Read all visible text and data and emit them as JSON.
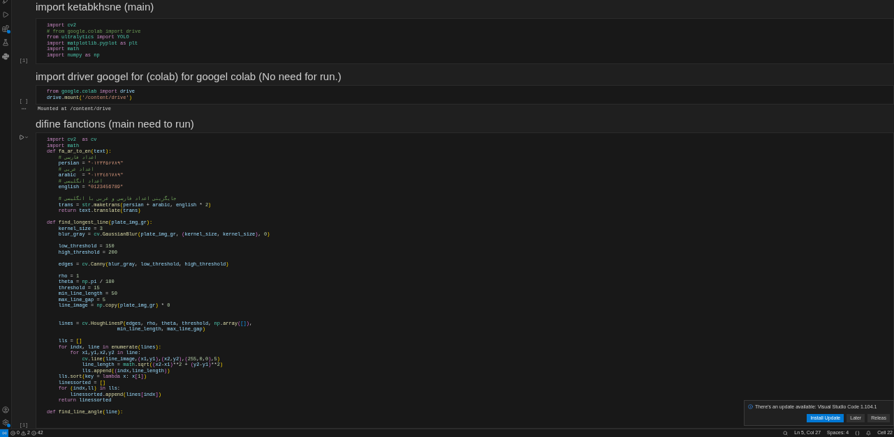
{
  "notebook": [
    {
      "kind": "markdown",
      "text": "import ketabkhsne (main)"
    },
    {
      "kind": "code",
      "run_button": false,
      "execution_label": "[1]",
      "lines": [
        {
          "kind": "code",
          "tokens": [
            {
              "kw": "import"
            },
            {
              "mod": " cv2"
            }
          ]
        },
        {
          "kind": "code",
          "tokens": [
            {
              "com": "# from google.colab import drive"
            }
          ]
        },
        {
          "kind": "code",
          "tokens": [
            {
              "kw": "from"
            },
            {
              "mod": " ultralytics "
            },
            {
              "kw": "import"
            },
            {
              "mod": " YOLO"
            }
          ]
        },
        {
          "kind": "code",
          "tokens": [
            {
              "kw": "import"
            },
            {
              "mod": " matplotlib.pyplot "
            },
            {
              "kw": "as"
            },
            {
              "mod": " plt"
            }
          ]
        },
        {
          "kind": "code",
          "tokens": [
            {
              "kw": "import"
            },
            {
              "mod": " math"
            }
          ]
        },
        {
          "kind": "code",
          "tokens": [
            {
              "kw": "import"
            },
            {
              "mod": " numpy "
            },
            {
              "kw": "as"
            },
            {
              "mod": " np"
            }
          ]
        }
      ]
    },
    {
      "kind": "markdown",
      "text": "import driver googel for (colab) for googel colab (No need for run.)"
    },
    {
      "kind": "code",
      "run_button": false,
      "execution_label": "[ ]",
      "lines": [
        {
          "kind": "code",
          "tokens": [
            {
              "kw": "from"
            },
            {
              "mod": " google.colab "
            },
            {
              "kw": "import"
            },
            {
              "var": " drive"
            }
          ]
        },
        {
          "kind": "code",
          "tokens": [
            {
              "var": "drive"
            },
            {
              "op": "."
            },
            {
              "fn": "mount"
            },
            {
              "br": "("
            },
            {
              "str": "'/content/drive'"
            },
            {
              "br": ")"
            }
          ]
        }
      ],
      "output": "Mounted at /content/drive"
    },
    {
      "kind": "markdown",
      "text": "difine fanctions (main need to run)"
    },
    {
      "kind": "code",
      "run_button": true,
      "execution_label": "[1]",
      "lines": [
        {
          "kind": "code",
          "tokens": [
            {
              "kw": "import"
            },
            {
              "mod": " cv2  "
            },
            {
              "kw": "as"
            },
            {
              "mod": " cv"
            }
          ]
        },
        {
          "kind": "code",
          "tokens": [
            {
              "kw": "import"
            },
            {
              "mod": " math"
            }
          ]
        },
        {
          "kind": "code",
          "tokens": [
            {
              "kw": "def"
            },
            {
              "fn": " fa_ar_to_en"
            },
            {
              "br": "("
            },
            {
              "var": "text"
            },
            {
              "br": "):"
            }
          ]
        },
        {
          "kind": "code",
          "tokens": [
            {
              "com": "    # اعداد فارسی"
            }
          ]
        },
        {
          "kind": "code",
          "tokens": [
            {
              "var": "    persian"
            },
            {
              "op": " = "
            },
            {
              "str": "\"۰۱۲۳۴۵۶۷۸۹\""
            }
          ]
        },
        {
          "kind": "code",
          "tokens": [
            {
              "com": "    # اعداد عربی"
            }
          ]
        },
        {
          "kind": "code",
          "tokens": [
            {
              "var": "    arabic"
            },
            {
              "op": "  = "
            },
            {
              "str": "\"٠١٢٣٤٥٦٧٨٩\""
            }
          ]
        },
        {
          "kind": "code",
          "tokens": [
            {
              "com": "    # اعداد انگلیسی"
            }
          ]
        },
        {
          "kind": "code",
          "tokens": [
            {
              "var": "    english"
            },
            {
              "op": " = "
            },
            {
              "str": "\"0123456789\""
            }
          ]
        },
        {
          "kind": "blank"
        },
        {
          "kind": "code",
          "tokens": [
            {
              "com": "    # جایگزینی اعداد فارسی و عربی با انگلیسی"
            }
          ]
        },
        {
          "kind": "code",
          "tokens": [
            {
              "var": "    trans"
            },
            {
              "op": " = "
            },
            {
              "mod": "str"
            },
            {
              "op": "."
            },
            {
              "fn": "maketrans"
            },
            {
              "br": "("
            },
            {
              "var": "persian"
            },
            {
              "op": " + "
            },
            {
              "var": "arabic"
            },
            {
              "op": ", "
            },
            {
              "var": "english"
            },
            {
              "op": " * "
            },
            {
              "num": "2"
            },
            {
              "br": ")"
            }
          ]
        },
        {
          "kind": "code",
          "tokens": [
            {
              "kw": "    return"
            },
            {
              "var": " text"
            },
            {
              "op": "."
            },
            {
              "fn": "translate"
            },
            {
              "br": "("
            },
            {
              "var": "trans"
            },
            {
              "br": ")"
            }
          ]
        },
        {
          "kind": "blank"
        },
        {
          "kind": "code",
          "tokens": [
            {
              "kw": "def"
            },
            {
              "fn": " find_longest_line"
            },
            {
              "br": "("
            },
            {
              "var": "plate_img_gr"
            },
            {
              "br": "):"
            }
          ]
        },
        {
          "kind": "code",
          "tokens": [
            {
              "var": "    kernel_size"
            },
            {
              "op": " = "
            },
            {
              "num": "3"
            }
          ]
        },
        {
          "kind": "code",
          "tokens": [
            {
              "var": "    blur_gray"
            },
            {
              "op": " = "
            },
            {
              "mod": "cv"
            },
            {
              "op": "."
            },
            {
              "fn": "GaussianBlur"
            },
            {
              "br": "("
            },
            {
              "var": "plate_img_gr"
            },
            {
              "op": ", "
            },
            {
              "br2": "("
            },
            {
              "var": "kernel_size"
            },
            {
              "op": ", "
            },
            {
              "var": "kernel_size"
            },
            {
              "br2": ")"
            },
            {
              "op": ", "
            },
            {
              "num": "0"
            },
            {
              "br": ")"
            }
          ]
        },
        {
          "kind": "blank"
        },
        {
          "kind": "code",
          "tokens": [
            {
              "var": "    low_threshold"
            },
            {
              "op": " = "
            },
            {
              "num": "150"
            }
          ]
        },
        {
          "kind": "code",
          "tokens": [
            {
              "var": "    high_threshold"
            },
            {
              "op": " = "
            },
            {
              "num": "200"
            }
          ]
        },
        {
          "kind": "blank"
        },
        {
          "kind": "code",
          "tokens": [
            {
              "var": "    edges"
            },
            {
              "op": " = "
            },
            {
              "mod": "cv"
            },
            {
              "op": "."
            },
            {
              "fn": "Canny"
            },
            {
              "br": "("
            },
            {
              "var": "blur_gray"
            },
            {
              "op": ", "
            },
            {
              "var": "low_threshold"
            },
            {
              "op": ", "
            },
            {
              "var": "high_threshold"
            },
            {
              "br": ")"
            }
          ]
        },
        {
          "kind": "blank"
        },
        {
          "kind": "code",
          "tokens": [
            {
              "var": "    rho"
            },
            {
              "op": " = "
            },
            {
              "num": "1"
            }
          ]
        },
        {
          "kind": "code",
          "tokens": [
            {
              "var": "    theta"
            },
            {
              "op": " = "
            },
            {
              "mod": "np"
            },
            {
              "op": "."
            },
            {
              "var": "pi"
            },
            {
              "op": " / "
            },
            {
              "num": "180"
            }
          ]
        },
        {
          "kind": "code",
          "tokens": [
            {
              "var": "    threshold"
            },
            {
              "op": " = "
            },
            {
              "num": "15"
            }
          ]
        },
        {
          "kind": "code",
          "tokens": [
            {
              "var": "    min_line_length"
            },
            {
              "op": " = "
            },
            {
              "num": "50"
            }
          ]
        },
        {
          "kind": "code",
          "tokens": [
            {
              "var": "    max_line_gap"
            },
            {
              "op": " = "
            },
            {
              "num": "5"
            }
          ]
        },
        {
          "kind": "code",
          "tokens": [
            {
              "var": "    line_image"
            },
            {
              "op": " = "
            },
            {
              "mod": "np"
            },
            {
              "op": "."
            },
            {
              "fn": "copy"
            },
            {
              "br": "("
            },
            {
              "var": "plate_img_gr"
            },
            {
              "br": ")"
            },
            {
              "op": " * "
            },
            {
              "num": "0"
            }
          ]
        },
        {
          "kind": "blank"
        },
        {
          "kind": "blank"
        },
        {
          "kind": "code",
          "tokens": [
            {
              "var": "    lines"
            },
            {
              "op": " = "
            },
            {
              "mod": "cv"
            },
            {
              "op": "."
            },
            {
              "fn": "HoughLinesP"
            },
            {
              "br": "("
            },
            {
              "var": "edges"
            },
            {
              "op": ", "
            },
            {
              "var": "rho"
            },
            {
              "op": ", "
            },
            {
              "var": "theta"
            },
            {
              "op": ", "
            },
            {
              "var": "threshold"
            },
            {
              "op": ", "
            },
            {
              "mod": "np"
            },
            {
              "op": "."
            },
            {
              "fn": "array"
            },
            {
              "br2": "("
            },
            {
              "br3": "[]"
            },
            {
              "br2": ")"
            },
            {
              "op": ","
            }
          ]
        },
        {
          "kind": "code",
          "tokens": [
            {
              "var": "                        min_line_length"
            },
            {
              "op": ", "
            },
            {
              "var": "max_line_gap"
            },
            {
              "br": ")"
            }
          ]
        },
        {
          "kind": "blank"
        },
        {
          "kind": "code",
          "tokens": [
            {
              "var": "    lls"
            },
            {
              "op": " = "
            },
            {
              "br": "[]"
            }
          ]
        },
        {
          "kind": "code",
          "tokens": [
            {
              "kw": "    for"
            },
            {
              "var": " indx"
            },
            {
              "op": ", "
            },
            {
              "var": "line"
            },
            {
              "kw": " in"
            },
            {
              "fn": " enumerate"
            },
            {
              "br": "("
            },
            {
              "var": "lines"
            },
            {
              "br": "):"
            }
          ]
        },
        {
          "kind": "code",
          "tokens": [
            {
              "kw": "        for"
            },
            {
              "var": " x1"
            },
            {
              "op": ","
            },
            {
              "var": "y1"
            },
            {
              "op": ","
            },
            {
              "var": "x2"
            },
            {
              "op": ","
            },
            {
              "var": "y2"
            },
            {
              "kw": " in"
            },
            {
              "var": " line"
            },
            {
              "op": ":"
            }
          ]
        },
        {
          "kind": "code",
          "tokens": [
            {
              "mod": "            cv"
            },
            {
              "op": "."
            },
            {
              "fn": "line"
            },
            {
              "br": "("
            },
            {
              "var": "line_image"
            },
            {
              "op": ","
            },
            {
              "br2": "("
            },
            {
              "var": "x1"
            },
            {
              "op": ","
            },
            {
              "var": "y1"
            },
            {
              "br2": ")"
            },
            {
              "op": ","
            },
            {
              "br2": "("
            },
            {
              "var": "x2"
            },
            {
              "op": ","
            },
            {
              "var": "y2"
            },
            {
              "br2": ")"
            },
            {
              "op": ","
            },
            {
              "br2": "("
            },
            {
              "num": "255"
            },
            {
              "op": ","
            },
            {
              "num": "0"
            },
            {
              "op": ","
            },
            {
              "num": "0"
            },
            {
              "br2": ")"
            },
            {
              "op": ","
            },
            {
              "num": "5"
            },
            {
              "br": ")"
            }
          ]
        },
        {
          "kind": "code",
          "tokens": [
            {
              "var": "            line_length"
            },
            {
              "op": " = "
            },
            {
              "mod": "math"
            },
            {
              "op": "."
            },
            {
              "fn": "sqrt"
            },
            {
              "br": "("
            },
            {
              "br2": "("
            },
            {
              "var": "x2"
            },
            {
              "op": "-"
            },
            {
              "var": "x1"
            },
            {
              "br2": ")"
            },
            {
              "op": "**"
            },
            {
              "num": "2"
            },
            {
              "op": " + "
            },
            {
              "br2": "("
            },
            {
              "var": "y2"
            },
            {
              "op": "-"
            },
            {
              "var": "y1"
            },
            {
              "br2": ")"
            },
            {
              "op": "**"
            },
            {
              "num": "2"
            },
            {
              "br": ")"
            }
          ]
        },
        {
          "kind": "code",
          "tokens": [
            {
              "var": "            lls"
            },
            {
              "op": "."
            },
            {
              "fn": "append"
            },
            {
              "br": "("
            },
            {
              "br2": "("
            },
            {
              "var": "indx"
            },
            {
              "op": ","
            },
            {
              "var": "line_length"
            },
            {
              "br2": ")"
            },
            {
              "br": ")"
            }
          ]
        },
        {
          "kind": "code",
          "tokens": [
            {
              "var": "    lls"
            },
            {
              "op": "."
            },
            {
              "fn": "sort"
            },
            {
              "br": "("
            },
            {
              "var": "key"
            },
            {
              "op": " = "
            },
            {
              "kw": "lambda"
            },
            {
              "var": " x"
            },
            {
              "op": ": "
            },
            {
              "var": "x"
            },
            {
              "br2": "["
            },
            {
              "num": "1"
            },
            {
              "br2": "]"
            },
            {
              "br": ")"
            }
          ]
        },
        {
          "kind": "code",
          "tokens": [
            {
              "var": "    linessorted"
            },
            {
              "op": " = "
            },
            {
              "br": "[]"
            }
          ]
        },
        {
          "kind": "code",
          "tokens": [
            {
              "kw": "    for"
            },
            {
              "br": " ("
            },
            {
              "var": "indx"
            },
            {
              "op": ","
            },
            {
              "var": "ll"
            },
            {
              "br": ")"
            },
            {
              "kw": " in"
            },
            {
              "var": " lls"
            },
            {
              "op": ":"
            }
          ]
        },
        {
          "kind": "code",
          "tokens": [
            {
              "var": "        linessorted"
            },
            {
              "op": "."
            },
            {
              "fn": "append"
            },
            {
              "br": "("
            },
            {
              "var": "lines"
            },
            {
              "br2": "["
            },
            {
              "var": "indx"
            },
            {
              "br2": "]"
            },
            {
              "br": ")"
            }
          ]
        },
        {
          "kind": "code",
          "tokens": [
            {
              "kw": "    return"
            },
            {
              "var": " linessorted"
            }
          ]
        },
        {
          "kind": "blank"
        },
        {
          "kind": "code",
          "tokens": [
            {
              "kw": "def"
            },
            {
              "fn": " find_line_angle"
            },
            {
              "br": "("
            },
            {
              "var": "line"
            },
            {
              "br": "):"
            }
          ]
        }
      ]
    }
  ],
  "notification": {
    "message": "There's an update available: Visual Studio Code 1.104.1",
    "buttons": [
      {
        "label": "Install Update",
        "primary": true
      },
      {
        "label": "Later",
        "primary": false
      },
      {
        "label": "Releas",
        "primary": false
      }
    ]
  },
  "status_bar": {
    "errors": "0",
    "warnings": "2",
    "info": "42",
    "position": "Ln 5, Col 27",
    "indent": "Spaces: 4",
    "cell": "Cell 22"
  }
}
